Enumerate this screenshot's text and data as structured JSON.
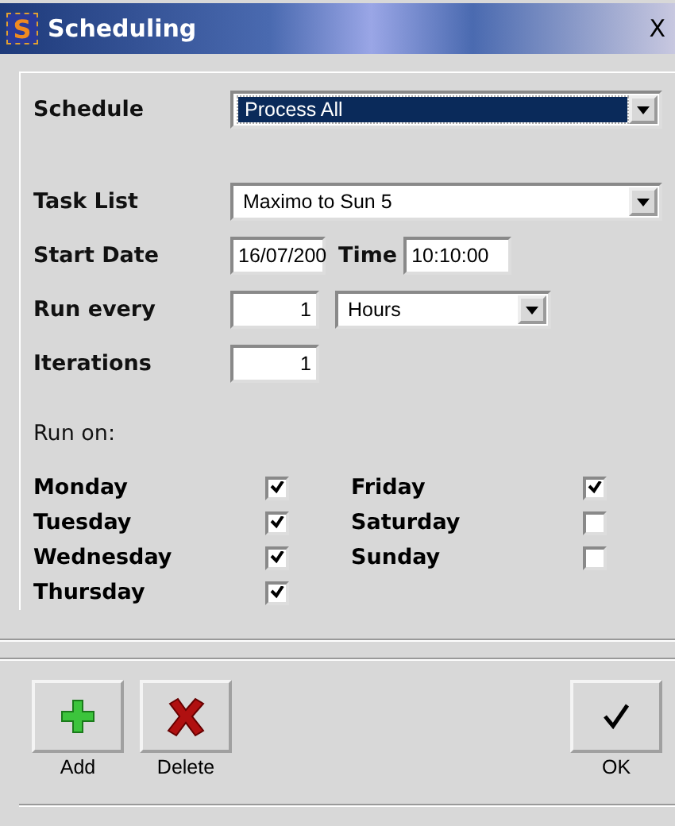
{
  "window": {
    "title": "Scheduling",
    "icon_letter": "S",
    "close": "X"
  },
  "schedule": {
    "label": "Schedule",
    "value": "Process All",
    "focused": true
  },
  "task_list": {
    "label": "Task List",
    "value": "Maximo to Sun 5",
    "focused": false
  },
  "start_date": {
    "label": "Start Date",
    "value": "16/07/200"
  },
  "time": {
    "label": "Time",
    "value": "10:10:00"
  },
  "run_every": {
    "label": "Run every",
    "value": "1",
    "unit": "Hours"
  },
  "iterations": {
    "label": "Iterations",
    "value": "1"
  },
  "run_on": {
    "label": "Run on:",
    "days": [
      {
        "label": "Monday",
        "checked": true
      },
      {
        "label": "Tuesday",
        "checked": true
      },
      {
        "label": "Wednesday",
        "checked": true
      },
      {
        "label": "Thursday",
        "checked": true
      },
      {
        "label": "Friday",
        "checked": true
      },
      {
        "label": "Saturday",
        "checked": false
      },
      {
        "label": "Sunday",
        "checked": false
      }
    ]
  },
  "buttons": [
    {
      "label": "Add",
      "kind": "add"
    },
    {
      "label": "Delete",
      "kind": "delete"
    },
    {
      "label": "OK",
      "kind": "ok"
    }
  ]
}
